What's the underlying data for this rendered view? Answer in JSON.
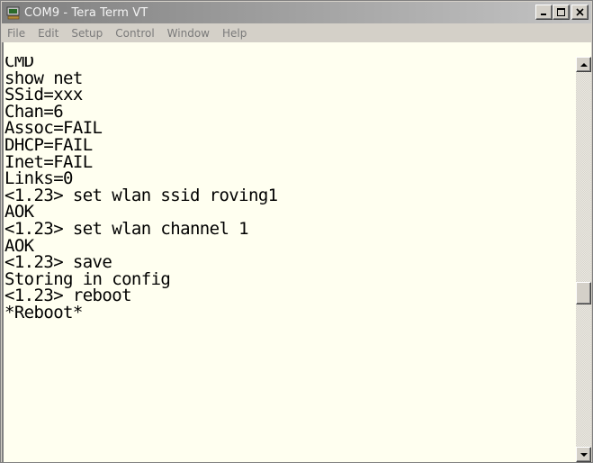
{
  "window": {
    "title": "COM9 - Tera Term VT",
    "minimize_label": "_",
    "maximize_label": "□",
    "close_label": "×"
  },
  "menu": {
    "items": [
      {
        "label": "File"
      },
      {
        "label": "Edit"
      },
      {
        "label": "Setup"
      },
      {
        "label": "Control"
      },
      {
        "label": "Window"
      },
      {
        "label": "Help"
      }
    ]
  },
  "terminal": {
    "lines": [
      "CMD",
      "show net",
      "SSid=xxx",
      "Chan=6",
      "Assoc=FAIL",
      "DHCP=FAIL",
      "Inet=FAIL",
      "Links=0",
      "<1.23> set wlan ssid roving1",
      "AOK",
      "<1.23> set wlan channel 1",
      "AOK",
      "<1.23> save",
      "Storing in config",
      "<1.23> reboot",
      "*Reboot*"
    ]
  },
  "colors": {
    "terminal_bg": "#FFFFF0",
    "titlebar_inactive": "#8E8E8E"
  },
  "icons": {
    "app": "tera-term-icon",
    "scroll_up": "arrow-up-icon",
    "scroll_down": "arrow-down-icon"
  }
}
